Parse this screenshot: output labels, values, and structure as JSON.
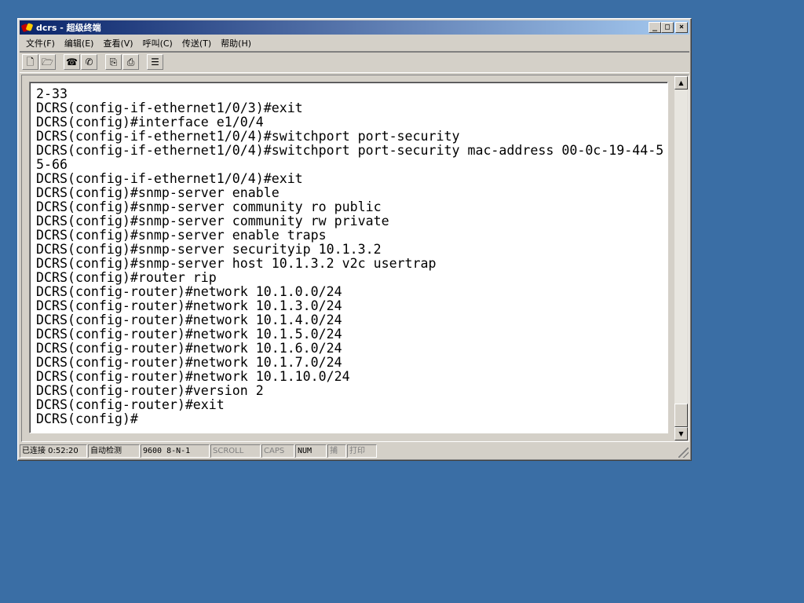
{
  "window": {
    "title": "dcrs - 超级终端"
  },
  "menu": [
    "文件(F)",
    "编辑(E)",
    "查看(V)",
    "呼叫(C)",
    "传送(T)",
    "帮助(H)"
  ],
  "toolbar": {
    "icons": [
      "new-icon",
      "open-icon",
      "disconnect-icon",
      "dial-icon",
      "send-icon",
      "receive-icon",
      "properties-icon"
    ]
  },
  "terminal": {
    "lines": [
      "2-33",
      "DCRS(config-if-ethernet1/0/3)#exit",
      "DCRS(config)#interface e1/0/4",
      "DCRS(config-if-ethernet1/0/4)#switchport port-security",
      "DCRS(config-if-ethernet1/0/4)#switchport port-security mac-address 00-0c-19-44-5",
      "5-66",
      "DCRS(config-if-ethernet1/0/4)#exit",
      "DCRS(config)#snmp-server enable",
      "DCRS(config)#snmp-server community ro public",
      "DCRS(config)#snmp-server community rw private",
      "DCRS(config)#snmp-server enable traps",
      "DCRS(config)#snmp-server securityip 10.1.3.2",
      "DCRS(config)#snmp-server host 10.1.3.2 v2c usertrap",
      "DCRS(config)#router rip",
      "DCRS(config-router)#network 10.1.0.0/24",
      "DCRS(config-router)#network 10.1.3.0/24",
      "DCRS(config-router)#network 10.1.4.0/24",
      "DCRS(config-router)#network 10.1.5.0/24",
      "DCRS(config-router)#network 10.1.6.0/24",
      "DCRS(config-router)#network 10.1.7.0/24",
      "DCRS(config-router)#network 10.1.10.0/24",
      "DCRS(config-router)#version 2",
      "DCRS(config-router)#exit",
      "DCRS(config)#"
    ]
  },
  "status": {
    "connected": "已连接 0:52:20",
    "detect": "自动检测",
    "baud": "9600 8-N-1",
    "scroll": "SCROLL",
    "caps": "CAPS",
    "num": "NUM",
    "capture": "捕",
    "print": "打印"
  }
}
